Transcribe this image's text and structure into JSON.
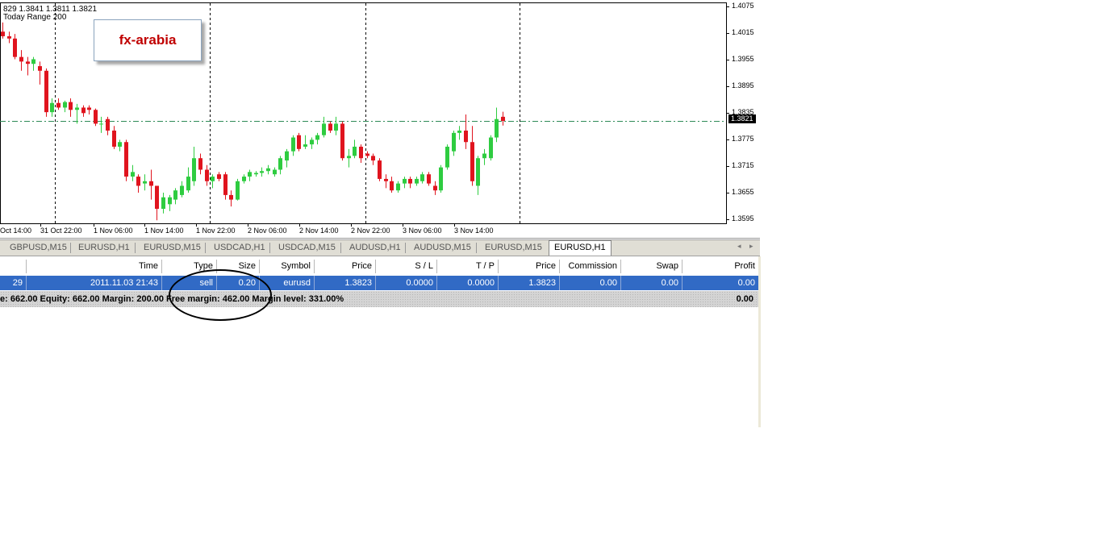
{
  "chart": {
    "ohlc_text": "829 1.3841 1.3811 1.3821",
    "range_text": "Today Range 200",
    "brand": "fx-arabia",
    "current_price": "1.3821",
    "price_labels": [
      "1.4075",
      "1.4015",
      "1.3955",
      "1.3895",
      "1.3835",
      "1.3775",
      "1.3715",
      "1.3655",
      "1.3595"
    ],
    "time_labels": [
      "Oct 14:00",
      "31 Oct 22:00",
      "1 Nov 06:00",
      "1 Nov 14:00",
      "1 Nov 22:00",
      "2 Nov 06:00",
      "2 Nov 14:00",
      "2 Nov 22:00",
      "3 Nov 06:00",
      "3 Nov 14:00"
    ],
    "colors": {
      "bull": "#2ecc40",
      "bear": "#e0141e",
      "grid": "#000000",
      "bid_line": "#2e8b57"
    }
  },
  "chart_data": {
    "type": "candlestick",
    "symbol": "EURUSD,H1",
    "ylim": [
      1.3595,
      1.4075
    ],
    "current": 1.3821,
    "candles": [
      {
        "o": 1.4015,
        "h": 1.4035,
        "l": 1.4,
        "c": 1.4005
      },
      {
        "o": 1.4005,
        "h": 1.4015,
        "l": 1.399,
        "c": 1.4
      },
      {
        "o": 1.4,
        "h": 1.401,
        "l": 1.3955,
        "c": 1.396
      },
      {
        "o": 1.396,
        "h": 1.3975,
        "l": 1.393,
        "c": 1.395
      },
      {
        "o": 1.395,
        "h": 1.396,
        "l": 1.392,
        "c": 1.3945
      },
      {
        "o": 1.3945,
        "h": 1.396,
        "l": 1.393,
        "c": 1.3955
      },
      {
        "o": 1.394,
        "h": 1.395,
        "l": 1.39,
        "c": 1.393
      },
      {
        "o": 1.393,
        "h": 1.3935,
        "l": 1.383,
        "c": 1.384
      },
      {
        "o": 1.384,
        "h": 1.387,
        "l": 1.383,
        "c": 1.386
      },
      {
        "o": 1.386,
        "h": 1.387,
        "l": 1.3845,
        "c": 1.385
      },
      {
        "o": 1.385,
        "h": 1.3865,
        "l": 1.384,
        "c": 1.3862
      },
      {
        "o": 1.3862,
        "h": 1.387,
        "l": 1.383,
        "c": 1.3845
      },
      {
        "o": 1.3845,
        "h": 1.3858,
        "l": 1.3815,
        "c": 1.385
      },
      {
        "o": 1.385,
        "h": 1.3855,
        "l": 1.383,
        "c": 1.3838
      },
      {
        "o": 1.385,
        "h": 1.3855,
        "l": 1.3835,
        "c": 1.3845
      },
      {
        "o": 1.3845,
        "h": 1.3848,
        "l": 1.381,
        "c": 1.3815
      },
      {
        "o": 1.3815,
        "h": 1.383,
        "l": 1.3795,
        "c": 1.3815
      },
      {
        "o": 1.3825,
        "h": 1.383,
        "l": 1.379,
        "c": 1.38
      },
      {
        "o": 1.38,
        "h": 1.381,
        "l": 1.376,
        "c": 1.3765
      },
      {
        "o": 1.3765,
        "h": 1.378,
        "l": 1.3755,
        "c": 1.3775
      },
      {
        "o": 1.3775,
        "h": 1.378,
        "l": 1.369,
        "c": 1.37
      },
      {
        "o": 1.37,
        "h": 1.3725,
        "l": 1.369,
        "c": 1.371
      },
      {
        "o": 1.37,
        "h": 1.3705,
        "l": 1.3665,
        "c": 1.368
      },
      {
        "o": 1.3685,
        "h": 1.3705,
        "l": 1.367,
        "c": 1.369
      },
      {
        "o": 1.369,
        "h": 1.3715,
        "l": 1.365,
        "c": 1.368
      },
      {
        "o": 1.368,
        "h": 1.368,
        "l": 1.3605,
        "c": 1.363
      },
      {
        "o": 1.363,
        "h": 1.3665,
        "l": 1.362,
        "c": 1.3655
      },
      {
        "o": 1.364,
        "h": 1.366,
        "l": 1.3625,
        "c": 1.3655
      },
      {
        "o": 1.365,
        "h": 1.3675,
        "l": 1.364,
        "c": 1.367
      },
      {
        "o": 1.366,
        "h": 1.369,
        "l": 1.3655,
        "c": 1.368
      },
      {
        "o": 1.367,
        "h": 1.372,
        "l": 1.3665,
        "c": 1.37
      },
      {
        "o": 1.369,
        "h": 1.3765,
        "l": 1.368,
        "c": 1.374
      },
      {
        "o": 1.374,
        "h": 1.375,
        "l": 1.3705,
        "c": 1.3715
      },
      {
        "o": 1.3715,
        "h": 1.3725,
        "l": 1.368,
        "c": 1.369
      },
      {
        "o": 1.369,
        "h": 1.3705,
        "l": 1.3675,
        "c": 1.37
      },
      {
        "o": 1.3705,
        "h": 1.371,
        "l": 1.369,
        "c": 1.3695
      },
      {
        "o": 1.3705,
        "h": 1.371,
        "l": 1.365,
        "c": 1.366
      },
      {
        "o": 1.366,
        "h": 1.367,
        "l": 1.3635,
        "c": 1.365
      },
      {
        "o": 1.365,
        "h": 1.3695,
        "l": 1.3648,
        "c": 1.369
      },
      {
        "o": 1.369,
        "h": 1.3705,
        "l": 1.3685,
        "c": 1.37
      },
      {
        "o": 1.37,
        "h": 1.3715,
        "l": 1.369,
        "c": 1.371
      },
      {
        "o": 1.3705,
        "h": 1.3712,
        "l": 1.37,
        "c": 1.3708
      },
      {
        "o": 1.3708,
        "h": 1.372,
        "l": 1.37,
        "c": 1.3712
      },
      {
        "o": 1.3712,
        "h": 1.3725,
        "l": 1.3705,
        "c": 1.3718
      },
      {
        "o": 1.3705,
        "h": 1.372,
        "l": 1.37,
        "c": 1.3715
      },
      {
        "o": 1.3715,
        "h": 1.3745,
        "l": 1.3705,
        "c": 1.374
      },
      {
        "o": 1.3735,
        "h": 1.376,
        "l": 1.372,
        "c": 1.3755
      },
      {
        "o": 1.3755,
        "h": 1.379,
        "l": 1.3745,
        "c": 1.3785
      },
      {
        "o": 1.379,
        "h": 1.3795,
        "l": 1.3755,
        "c": 1.376
      },
      {
        "o": 1.3765,
        "h": 1.379,
        "l": 1.376,
        "c": 1.377
      },
      {
        "o": 1.377,
        "h": 1.3785,
        "l": 1.376,
        "c": 1.378
      },
      {
        "o": 1.378,
        "h": 1.3795,
        "l": 1.377,
        "c": 1.379
      },
      {
        "o": 1.379,
        "h": 1.383,
        "l": 1.3785,
        "c": 1.3815
      },
      {
        "o": 1.3815,
        "h": 1.382,
        "l": 1.3795,
        "c": 1.38
      },
      {
        "o": 1.38,
        "h": 1.383,
        "l": 1.379,
        "c": 1.3815
      },
      {
        "o": 1.3815,
        "h": 1.382,
        "l": 1.3735,
        "c": 1.374
      },
      {
        "o": 1.374,
        "h": 1.376,
        "l": 1.372,
        "c": 1.3745
      },
      {
        "o": 1.3745,
        "h": 1.378,
        "l": 1.374,
        "c": 1.3765
      },
      {
        "o": 1.3765,
        "h": 1.377,
        "l": 1.373,
        "c": 1.374
      },
      {
        "o": 1.375,
        "h": 1.3755,
        "l": 1.374,
        "c": 1.3745
      },
      {
        "o": 1.3745,
        "h": 1.375,
        "l": 1.3725,
        "c": 1.3735
      },
      {
        "o": 1.3735,
        "h": 1.374,
        "l": 1.369,
        "c": 1.3695
      },
      {
        "o": 1.3695,
        "h": 1.3705,
        "l": 1.3675,
        "c": 1.369
      },
      {
        "o": 1.369,
        "h": 1.37,
        "l": 1.3665,
        "c": 1.367
      },
      {
        "o": 1.367,
        "h": 1.369,
        "l": 1.3665,
        "c": 1.3685
      },
      {
        "o": 1.3685,
        "h": 1.37,
        "l": 1.3675,
        "c": 1.3695
      },
      {
        "o": 1.3695,
        "h": 1.37,
        "l": 1.3675,
        "c": 1.3685
      },
      {
        "o": 1.3685,
        "h": 1.37,
        "l": 1.368,
        "c": 1.3695
      },
      {
        "o": 1.369,
        "h": 1.371,
        "l": 1.3685,
        "c": 1.3705
      },
      {
        "o": 1.3705,
        "h": 1.371,
        "l": 1.368,
        "c": 1.3685
      },
      {
        "o": 1.368,
        "h": 1.369,
        "l": 1.366,
        "c": 1.367
      },
      {
        "o": 1.367,
        "h": 1.3725,
        "l": 1.3665,
        "c": 1.372
      },
      {
        "o": 1.372,
        "h": 1.377,
        "l": 1.3715,
        "c": 1.3765
      },
      {
        "o": 1.3755,
        "h": 1.38,
        "l": 1.3745,
        "c": 1.3795
      },
      {
        "o": 1.3795,
        "h": 1.381,
        "l": 1.378,
        "c": 1.38
      },
      {
        "o": 1.38,
        "h": 1.3835,
        "l": 1.376,
        "c": 1.3775
      },
      {
        "o": 1.3775,
        "h": 1.381,
        "l": 1.368,
        "c": 1.369
      },
      {
        "o": 1.368,
        "h": 1.3745,
        "l": 1.366,
        "c": 1.374
      },
      {
        "o": 1.374,
        "h": 1.376,
        "l": 1.3725,
        "c": 1.375
      },
      {
        "o": 1.374,
        "h": 1.379,
        "l": 1.3735,
        "c": 1.3785
      },
      {
        "o": 1.3785,
        "h": 1.385,
        "l": 1.3775,
        "c": 1.3825
      },
      {
        "o": 1.383,
        "h": 1.3841,
        "l": 1.3811,
        "c": 1.3821
      }
    ]
  },
  "tabs": [
    {
      "label": "GBPUSD,M15"
    },
    {
      "label": "EURUSD,H1"
    },
    {
      "label": "EURUSD,M15"
    },
    {
      "label": "USDCAD,H1"
    },
    {
      "label": "USDCAD,M15"
    },
    {
      "label": "AUDUSD,H1"
    },
    {
      "label": "AUDUSD,M15"
    },
    {
      "label": "EURUSD,M15"
    },
    {
      "label": "EURUSD,H1"
    }
  ],
  "terminal": {
    "columns": [
      "",
      "Time",
      "Type",
      "Size",
      "Symbol",
      "Price",
      "S / L",
      "T / P",
      "Price",
      "Commission",
      "Swap",
      "Profit"
    ],
    "order": [
      "29",
      "2011.11.03 21:43",
      "sell",
      "0.20",
      "eurusd",
      "1.3823",
      "0.0000",
      "0.0000",
      "1.3823",
      "0.00",
      "0.00",
      "0.00"
    ],
    "balance_text": "e: 662.00  Equity: 662.00  Margin: 200.00  Free margin: 462.00  Margin level: 331.00%",
    "balance_profit": "0.00"
  }
}
